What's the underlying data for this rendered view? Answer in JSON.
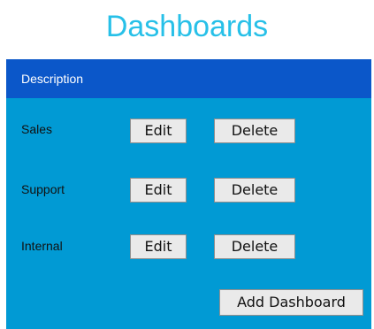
{
  "page": {
    "title": "Dashboards"
  },
  "table": {
    "header": "Description",
    "rows": [
      {
        "name": "Sales",
        "edit_label": "Edit",
        "delete_label": "Delete"
      },
      {
        "name": "Support",
        "edit_label": "Edit",
        "delete_label": "Delete"
      },
      {
        "name": "Internal",
        "edit_label": "Edit",
        "delete_label": "Delete"
      }
    ]
  },
  "actions": {
    "add_label": "Add Dashboard"
  },
  "colors": {
    "title": "#27c0e8",
    "header_bg": "#0b57c9",
    "panel_bg": "#019ad4",
    "button_bg": "#eaeaea"
  }
}
